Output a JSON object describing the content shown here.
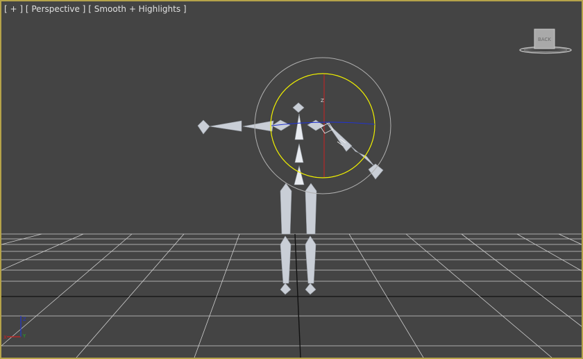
{
  "viewport": {
    "menu_label": "[ + ]",
    "view_label": "[ Perspective ]",
    "shading_label": "[ Smooth + Highlights ]"
  },
  "viewcube": {
    "face_label": "BACK"
  },
  "gizmo": {
    "axis_z": "Z"
  },
  "axis_tripod": {
    "x": "X",
    "y": "Y",
    "z": "Z"
  },
  "colors": {
    "viewport_bg": "#444444",
    "active_border": "#b5a34a",
    "grid": "#cfcfcf",
    "bone": "#c9ced6",
    "rotate_outer": "#b0b0b0",
    "rotate_screen": "#f0f000",
    "axis_x": "#cc2222",
    "axis_y": "#22aa22",
    "axis_z": "#2233cc"
  }
}
